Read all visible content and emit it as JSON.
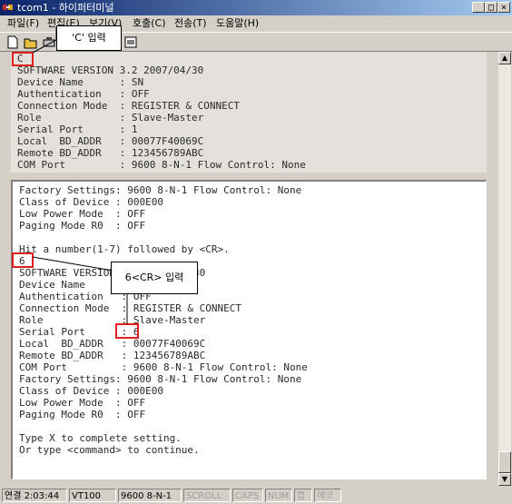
{
  "window": {
    "title": "tcom1 - 하이퍼터미널",
    "min": "_",
    "max": "□",
    "close": "×"
  },
  "menu": [
    "파일(F)",
    "편집(E)",
    "보기(V)",
    "호출(C)",
    "전송(T)",
    "도움말(H)"
  ],
  "top_pane": {
    "lines": [
      "C",
      "SOFTWARE VERSION 3.2 2007/04/30",
      "Device Name      : SN",
      "Authentication   : OFF",
      "Connection Mode  : REGISTER & CONNECT",
      "Role             : Slave-Master",
      "Serial Port      : 1",
      "Local  BD_ADDR   : 00077F40069C",
      "Remote BD_ADDR   : 123456789ABC",
      "COM Port         : 9600 8-N-1 Flow Control: None"
    ]
  },
  "bottom_pane": {
    "lines": [
      "Factory Settings: 9600 8-N-1 Flow Control: None",
      "Class of Device : 000E00",
      "Low Power Mode  : OFF",
      "Paging Mode R0  : OFF",
      "",
      "Hit a number(1-7) followed by <CR>.",
      "6",
      "SOFTWARE VERSION 3.2 2007/04/30",
      "Device Name      : SN",
      "Authentication   : OFF",
      "Connection Mode  : REGISTER & CONNECT",
      "Role             : Slave-Master",
      "Serial Port      : 6",
      "Local  BD_ADDR   : 00077F40069C",
      "Remote BD_ADDR   : 123456789ABC",
      "COM Port         : 9600 8-N-1 Flow Control: None",
      "Factory Settings: 9600 8-N-1 Flow Control: None",
      "Class of Device : 000E00",
      "Low Power Mode  : OFF",
      "Paging Mode R0  : OFF",
      "",
      "Type X to complete setting.",
      "Or type <command> to continue."
    ]
  },
  "callouts": {
    "c_input": "'C' 입력",
    "six_input": "6<CR> 입력"
  },
  "status": {
    "connected": "연결 2:03:44",
    "terminal": "VT100",
    "settings": "9600 8-N-1",
    "scroll": "SCROLL",
    "caps": "CAPS",
    "num": "NUM",
    "capture": "캡",
    "print": "에코"
  },
  "colors": {
    "highlight": "#e02020",
    "title_start": "#0a246a"
  }
}
